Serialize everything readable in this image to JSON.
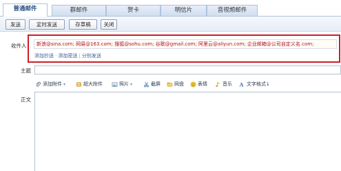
{
  "tabs": [
    {
      "label": "普通邮件",
      "active": true
    },
    {
      "label": "群邮件",
      "active": false
    },
    {
      "label": "贺卡",
      "active": false
    },
    {
      "label": "明信片",
      "active": false
    },
    {
      "label": "音视频邮件",
      "active": false
    }
  ],
  "toolbar": {
    "send": "发送",
    "scheduled_send": "定时发送",
    "save_draft": "存草稿",
    "close": "关闭"
  },
  "form": {
    "to_label": "收件人",
    "to_value": "新浪@sina.com;  网易@163.com;  搜狐@sohu.com;  谷歌@gmail.com;  阿里云@aliyun.com;  企业邮箱@公司自定义名.com;",
    "add_cc": "添加抄送",
    "add_bcc": "添加密送",
    "send_separately": "分别发送",
    "subject_label": "主题",
    "body_label": "正文"
  },
  "editbar": {
    "add_attachment": "添加附件",
    "large_attachment": "超大附件",
    "photo": "照片",
    "screenshot": "截屏",
    "netdisk": "网盘",
    "emoticon": "表情",
    "music": "音乐",
    "text_format": "文字格式↓"
  },
  "colors": {
    "highlight_border": "#cc1e27",
    "recipient_text": "#b1102a",
    "link": "#385e95"
  }
}
